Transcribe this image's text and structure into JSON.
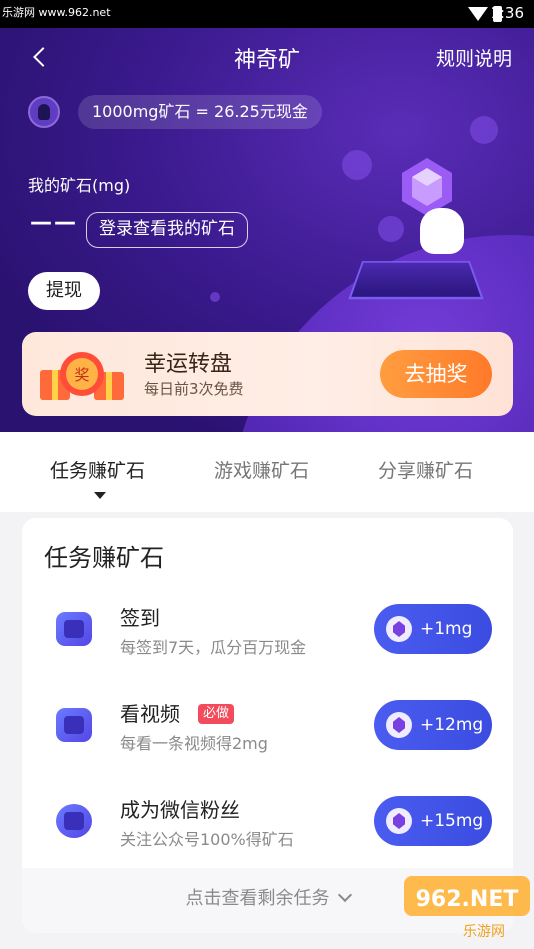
{
  "statusbar": {
    "brand": "乐游网 www.962.net",
    "time": "1:36"
  },
  "navbar": {
    "title": "神奇矿",
    "rules": "规则说明"
  },
  "rate": {
    "text": "1000mg矿石 = 26.25元现金"
  },
  "mine": {
    "label": "我的矿石(mg)",
    "value": "——",
    "login": "登录查看我的矿石",
    "withdraw": "提现"
  },
  "lucky": {
    "title": "幸运转盘",
    "subtitle": "每日前3次免费",
    "button": "去抽奖",
    "gift_text": "奖"
  },
  "tabs": [
    {
      "label": "任务赚矿石",
      "active": true
    },
    {
      "label": "游戏赚矿石",
      "active": false
    },
    {
      "label": "分享赚矿石",
      "active": false
    }
  ],
  "card": {
    "title": "任务赚矿石",
    "tasks": [
      {
        "name": "签到",
        "desc": "每签到7天，瓜分百万现金",
        "reward": "+1mg",
        "badge": "",
        "icon": "calendar-icon"
      },
      {
        "name": "看视频",
        "desc": "每看一条视频得2mg",
        "reward": "+12mg",
        "badge": "必做",
        "icon": "video-icon"
      },
      {
        "name": "成为微信粉丝",
        "desc": "关注公众号100%得矿石",
        "reward": "+15mg",
        "badge": "",
        "icon": "chat-icon"
      }
    ],
    "more": "点击查看剩余任务"
  },
  "watermark": {
    "text1": "962.NET",
    "text2": "乐游网"
  },
  "colors": {
    "hero": "#3b1a8e",
    "accent": "#4b5cf0",
    "orange": "#ff8a33",
    "badge": "#f24c5c"
  }
}
